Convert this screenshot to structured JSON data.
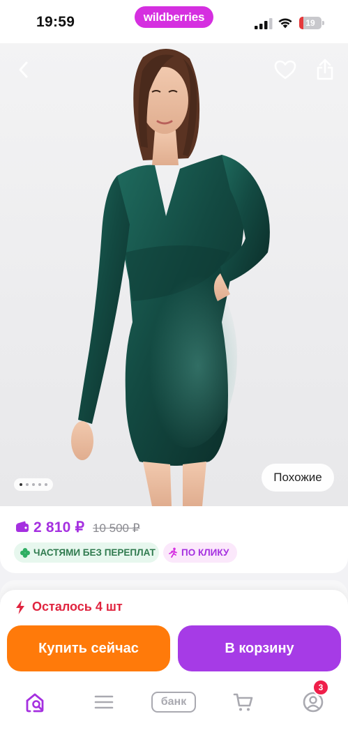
{
  "status_bar": {
    "time": "19:59",
    "brand": "wildberries",
    "battery_level": "19",
    "battery_fraction": 0.19,
    "icons": [
      "signal-icon",
      "wifi-icon",
      "battery-icon"
    ]
  },
  "photo": {
    "gallery_total": 5,
    "gallery_active_index": 0,
    "similar_label": "Похожие",
    "icons": [
      "back-chevron-icon",
      "heart-icon",
      "share-icon"
    ]
  },
  "price": {
    "current": "2 810 ₽",
    "old": "10 500 ₽",
    "tags": [
      {
        "label": "ЧАСТЯМИ БЕЗ ПЕРЕПЛАТ",
        "icon": "clover-icon"
      },
      {
        "label": "ПО КЛИКУ",
        "icon": "running-person-icon"
      }
    ]
  },
  "purchase": {
    "stock_text": "Осталось 4 шт",
    "buy_now_label": "Купить сейчас",
    "add_to_cart_label": "В корзину"
  },
  "tabbar": {
    "bank_label": "банк",
    "badge_count": "3",
    "icons": [
      "home-search-icon",
      "catalog-menu-icon",
      "bank-icon",
      "cart-icon",
      "profile-icon"
    ]
  },
  "colors": {
    "brand": "#d52fe0",
    "price_accent": "#a530e0",
    "buy_now": "#ff7a0a",
    "add_to_cart": "#a63be6",
    "stock_warning": "#e0243f",
    "installment_green": "#2f7a4e"
  }
}
